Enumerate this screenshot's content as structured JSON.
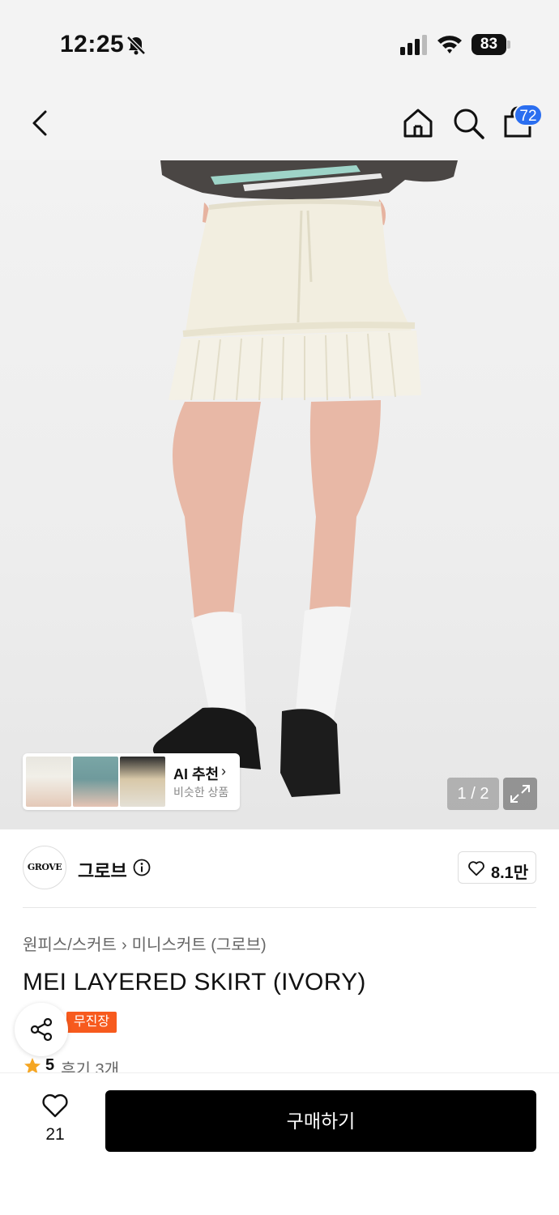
{
  "status_bar": {
    "time": "12:25",
    "battery": "83"
  },
  "nav": {
    "cart_count": "72"
  },
  "gallery": {
    "page_indicator": "1 / 2"
  },
  "ai_recommend": {
    "title": "AI 추천",
    "subtitle": "비슷한 상품"
  },
  "brand": {
    "logo_text": "GROVE",
    "name": "그로브",
    "likes": "8.1만"
  },
  "breadcrumb": {
    "category": "원피스/스커트",
    "subcategory": "미니스커트 (그로브)"
  },
  "product": {
    "title": "MEI LAYERED SKIRT (IVORY)",
    "tag": "무진장"
  },
  "rating": {
    "score": "5",
    "reviews": "후기 3개"
  },
  "bottom": {
    "wish_count": "21",
    "buy_label": "구매하기"
  },
  "colors": {
    "accent_blue": "#2a6ef0",
    "tag_orange": "#f75a1d",
    "star": "#f5a623"
  }
}
